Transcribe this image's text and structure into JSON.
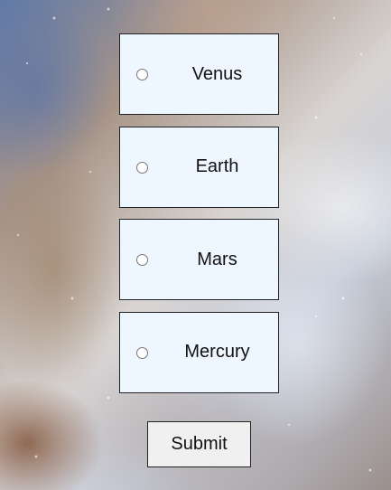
{
  "quiz": {
    "options": [
      {
        "label": "Venus",
        "selected": false
      },
      {
        "label": "Earth",
        "selected": false
      },
      {
        "label": "Mars",
        "selected": false
      },
      {
        "label": "Mercury",
        "selected": false
      }
    ],
    "submit_label": "Submit"
  }
}
